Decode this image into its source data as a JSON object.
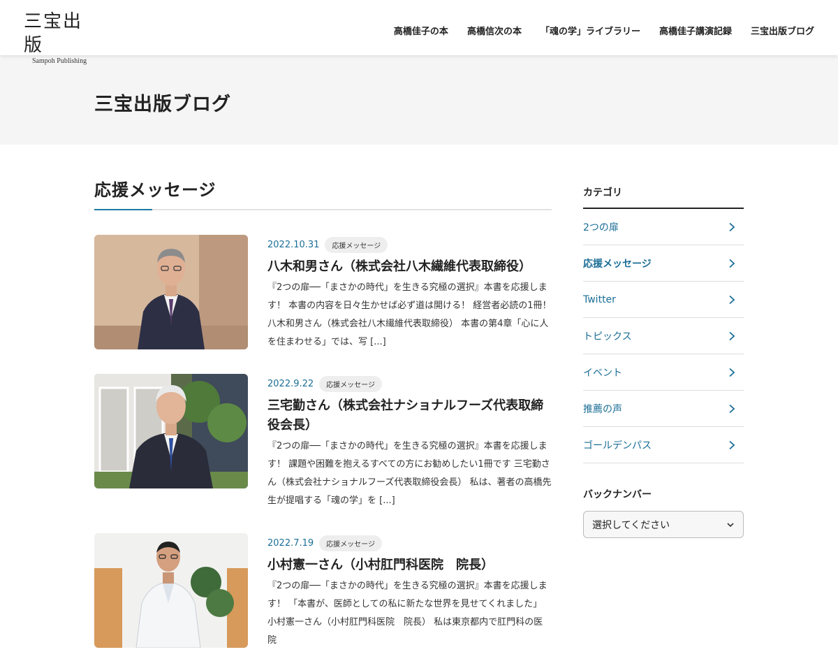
{
  "header": {
    "logo_main": "三宝出版",
    "logo_sub": "Sampoh Publishing",
    "nav": [
      {
        "label": "高橋佳子の本"
      },
      {
        "label": "高橋信次の本"
      },
      {
        "label": "「魂の学」ライブラリー"
      },
      {
        "label": "高橋佳子講演記録"
      },
      {
        "label": "三宝出版ブログ"
      }
    ]
  },
  "page": {
    "title": "三宝出版ブログ",
    "category_heading": "応援メッセージ"
  },
  "posts": [
    {
      "date": "2022.10.31",
      "tag": "応援メッセージ",
      "title": "八木和男さん（株式会社八木繊維代表取締役）",
      "excerpt": "『2つの扉──「まさかの時代」を生きる究極の選択』本書を応援します！ 本書の内容を日々生かせば必ず道は開ける！ 経営者必読の1冊！ 八木和男さん（株式会社八木繊維代表取締役） 本書の第4章「心に人を住まわせる」では、写 [...]"
    },
    {
      "date": "2022.9.22",
      "tag": "応援メッセージ",
      "title": "三宅勤さん（株式会社ナショナルフーズ代表取締役会長）",
      "excerpt": "『2つの扉──「まさかの時代」を生きる究極の選択』本書を応援します！ 課題や困難を抱えるすべての方にお勧めしたい1冊です 三宅勤さん（株式会社ナショナルフーズ代表取締役会長） 私は、著者の高橋先生が提唱する「魂の学」を [...]"
    },
    {
      "date": "2022.7.19",
      "tag": "応援メッセージ",
      "title": "小村憲一さん（小村肛門科医院　院長）",
      "excerpt": "『2つの扉──「まさかの時代」を生きる究極の選択』本書を応援します！ 「本書が、医師としての私に新たな世界を見せてくれました」 小村憲一さん（小村肛門科医院　院長） 私は東京都内で肛門科の医院"
    }
  ],
  "sidebar": {
    "category_title": "カテゴリ",
    "categories": [
      {
        "label": "2つの扉"
      },
      {
        "label": "応援メッセージ"
      },
      {
        "label": "Twitter"
      },
      {
        "label": "トピックス"
      },
      {
        "label": "イベント"
      },
      {
        "label": "推薦の声"
      },
      {
        "label": "ゴールデンパス"
      }
    ],
    "back_number_title": "バックナンバー",
    "select_value": "選択してください"
  },
  "colors": {
    "accent": "#1b6e96",
    "band": "#f5f5f5"
  },
  "icons": {
    "category_arrow": "chevron-right-icon",
    "select_arrow": "chevron-down-icon"
  }
}
